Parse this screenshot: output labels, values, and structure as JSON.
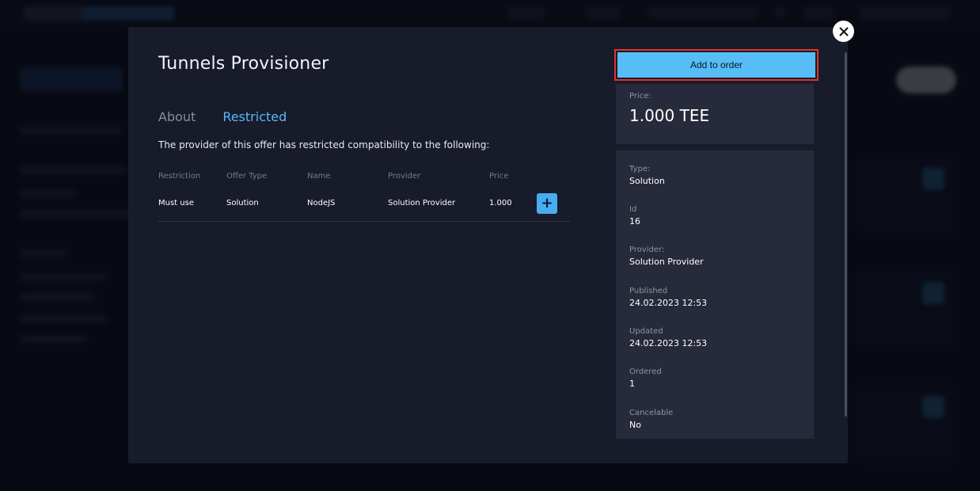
{
  "modal": {
    "title": "Tunnels Provisioner",
    "tabs": [
      {
        "label": "About",
        "active": false
      },
      {
        "label": "Restricted",
        "active": true
      }
    ],
    "description": "The provider of this offer has restricted compatibility to the following:",
    "table": {
      "headers": [
        "Restriction",
        "Offer Type",
        "Name",
        "Provider",
        "Price"
      ],
      "rows": [
        {
          "restriction": "Must use",
          "offer_type": "Solution",
          "name": "NodeJS",
          "provider": "Solution Provider",
          "price": "1.000"
        }
      ]
    },
    "add_to_order_label": "Add to order",
    "price": {
      "label": "Price:",
      "value": "1.000 TEE"
    },
    "info": [
      {
        "label": "Type:",
        "value": "Solution"
      },
      {
        "label": "Id",
        "value": "16"
      },
      {
        "label": "Provider:",
        "value": "Solution Provider"
      },
      {
        "label": "Published",
        "value": "24.02.2023 12:53"
      },
      {
        "label": "Updated",
        "value": "24.02.2023 12:53"
      },
      {
        "label": "Ordered",
        "value": "1"
      },
      {
        "label": "Cancelable",
        "value": "No"
      }
    ],
    "close_icon": "close-icon",
    "plus_icon": "plus-icon"
  },
  "colors": {
    "accent": "#58b7ff",
    "button": "#57bdf6",
    "highlight_border": "#e0322e",
    "modal_bg": "#181b29",
    "card_bg": "#262a3a"
  }
}
